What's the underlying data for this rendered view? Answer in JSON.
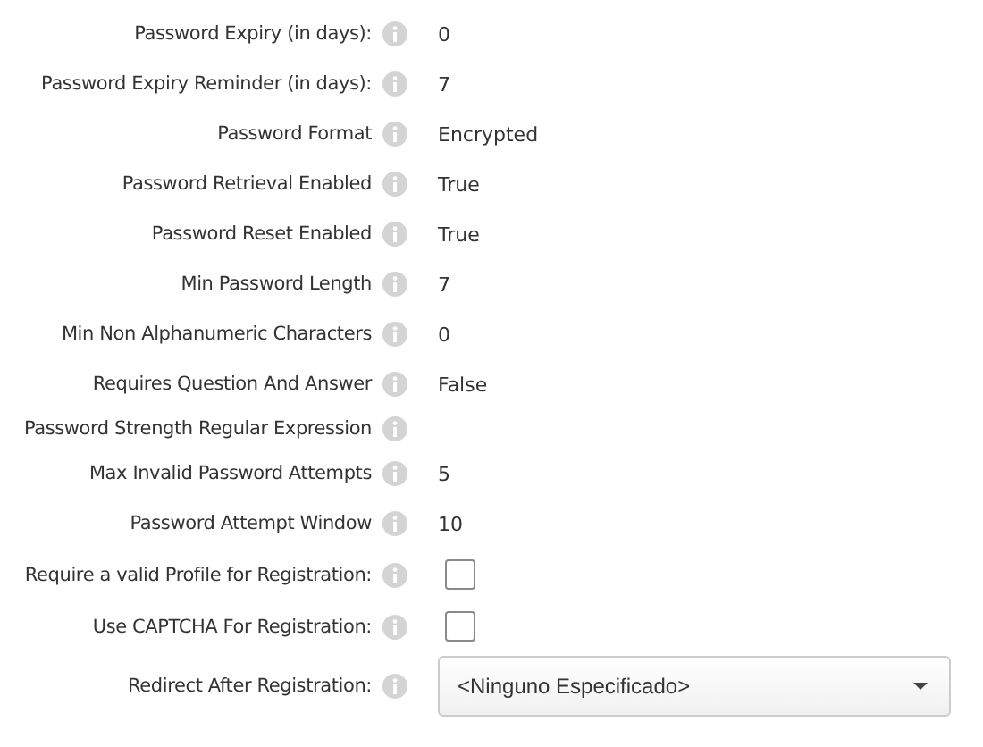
{
  "settings": [
    {
      "kind": "text",
      "label": "Password Expiry (in days):",
      "value": "0"
    },
    {
      "kind": "text",
      "label": "Password Expiry Reminder (in days):",
      "value": "7"
    },
    {
      "kind": "text",
      "label": "Password Format",
      "value": "Encrypted"
    },
    {
      "kind": "text",
      "label": "Password Retrieval Enabled",
      "value": "True"
    },
    {
      "kind": "text",
      "label": "Password Reset Enabled",
      "value": "True"
    },
    {
      "kind": "text",
      "label": "Min Password Length",
      "value": "7"
    },
    {
      "kind": "text",
      "label": "Min Non Alphanumeric Characters",
      "value": "0"
    },
    {
      "kind": "text",
      "label": "Requires Question And Answer",
      "value": "False"
    },
    {
      "kind": "empty",
      "label": "Password Strength Regular Expression"
    },
    {
      "kind": "text",
      "label": "Max Invalid Password Attempts",
      "value": "5"
    },
    {
      "kind": "text",
      "label": "Password Attempt Window",
      "value": "10"
    },
    {
      "kind": "checkbox",
      "label": "Require a valid Profile for Registration:",
      "checked": false
    },
    {
      "kind": "checkbox",
      "label": "Use CAPTCHA For Registration:",
      "checked": false
    },
    {
      "kind": "select",
      "label": "Redirect After Registration:",
      "value": "<Ninguno Especificado>"
    }
  ]
}
